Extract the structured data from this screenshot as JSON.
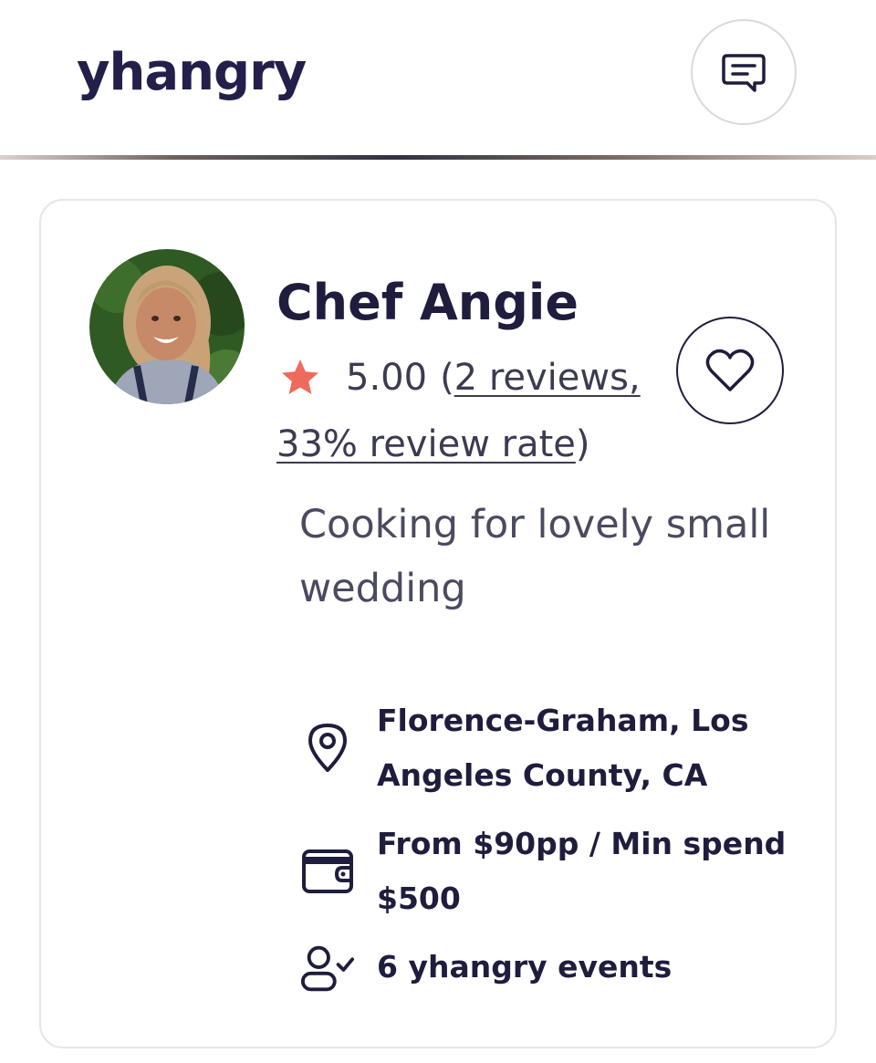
{
  "header": {
    "logo_text": "yhangry",
    "chat_icon": "chat-icon"
  },
  "chef": {
    "name": "Chef Angie",
    "rating": "5.00",
    "reviews_open_paren": "(",
    "reviews_link": "2 reviews,",
    "review_rate_link": "33% review rate",
    "close_paren": ")",
    "tagline": "Cooking for lovely small wedding",
    "favorite_icon": "heart-icon",
    "star_color": "#ee6a5c"
  },
  "details": {
    "location": "Florence-Graham, Los Angeles County, CA",
    "price": "From $90pp / Min spend $500",
    "events": "6 yhangry events"
  }
}
